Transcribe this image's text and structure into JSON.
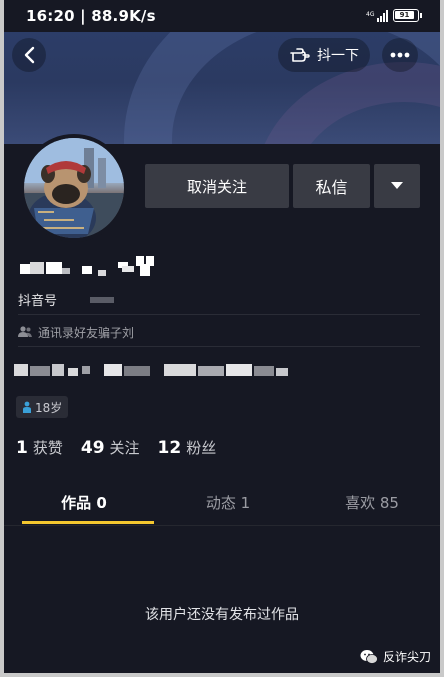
{
  "status_bar": {
    "time": "16:20 | 88.9K/s",
    "network": "4G",
    "battery": "91"
  },
  "header": {
    "shake_label": "抖一下"
  },
  "profile": {
    "unfollow_label": "取消关注",
    "message_label": "私信",
    "douyin_id_label": "抖音号",
    "contacts_text": "通讯录好友骗子刘",
    "age_text": "18岁"
  },
  "stats": [
    {
      "num": "1",
      "label": "获赞"
    },
    {
      "num": "49",
      "label": "关注"
    },
    {
      "num": "12",
      "label": "粉丝"
    }
  ],
  "tabs": [
    {
      "label": "作品 0"
    },
    {
      "label": "动态 1"
    },
    {
      "label": "喜欢 85"
    }
  ],
  "empty_state": "该用户还没有发布过作品",
  "watermark": "反诈尖刀",
  "colors": {
    "background": "#161823",
    "button": "#393b44",
    "tab_indicator": "#f4c72f"
  }
}
